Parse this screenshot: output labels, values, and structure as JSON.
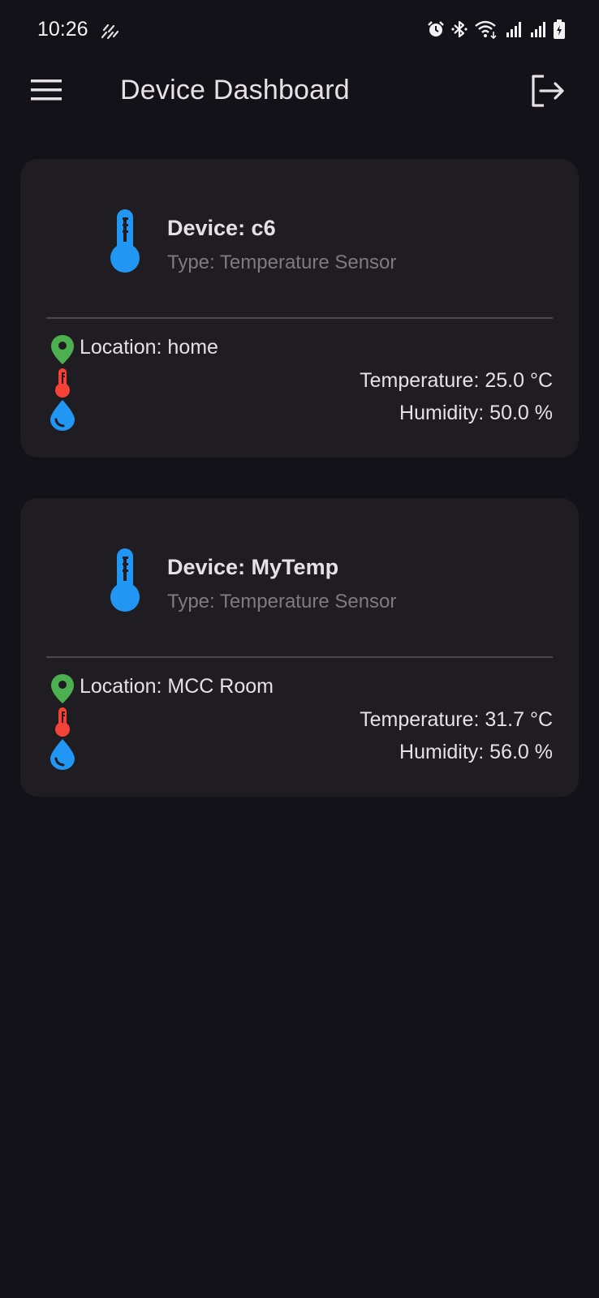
{
  "status_bar": {
    "time": "10:26",
    "icons": [
      "weather-icon",
      "alarm-icon",
      "bluetooth-icon",
      "wifi-icon",
      "signal-icon",
      "signal-icon",
      "battery-icon"
    ]
  },
  "app_bar": {
    "title": "Device Dashboard",
    "menu_icon": "menu-icon",
    "logout_icon": "logout-icon"
  },
  "colors": {
    "background": "#141219",
    "card": "#1f1d22",
    "device_icon": "#2196f3",
    "location_icon": "#4caf50",
    "temperature_icon": "#f44336",
    "humidity_icon": "#2196f3",
    "type_text": "#7d7a80"
  },
  "devices": [
    {
      "name": "Device: c6",
      "type": "Type: Temperature Sensor",
      "location": "Location: home",
      "temperature": "Temperature: 25.0 °C",
      "humidity": "Humidity: 50.0 %"
    },
    {
      "name": "Device: MyTemp",
      "type": "Type: Temperature Sensor",
      "location": "Location: MCC Room",
      "temperature": "Temperature: 31.7 °C",
      "humidity": "Humidity: 56.0 %"
    }
  ]
}
